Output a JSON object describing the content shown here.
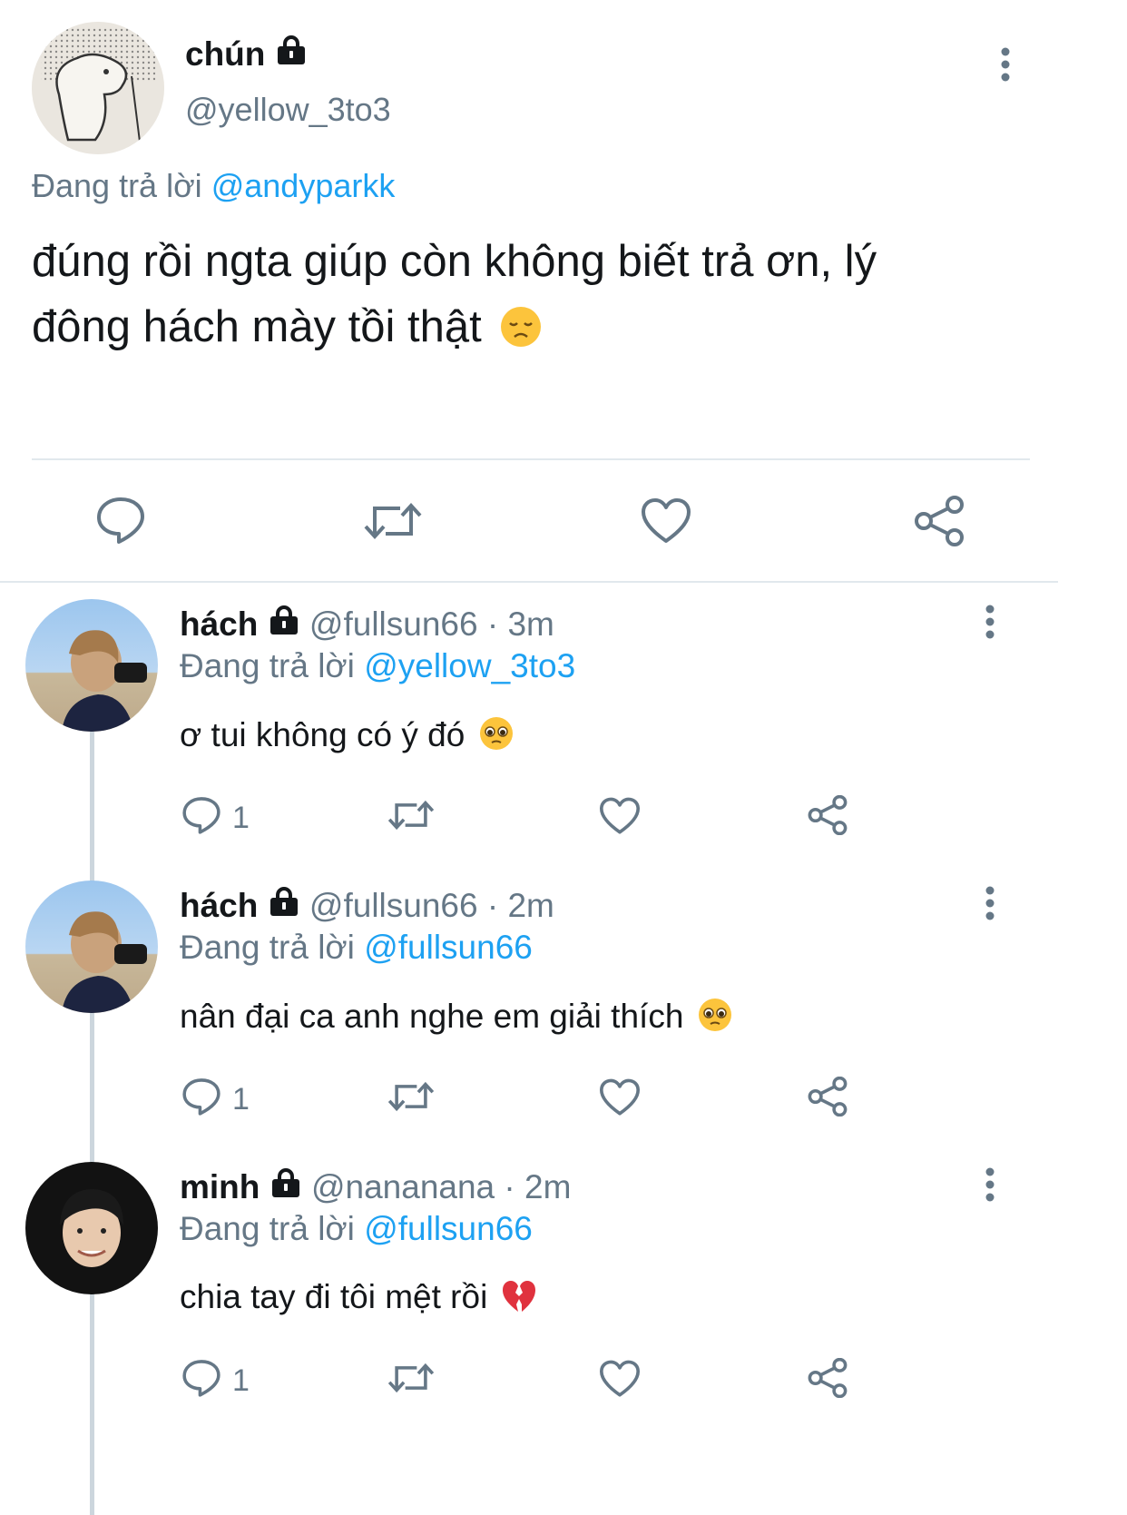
{
  "main_tweet": {
    "display_name": "chún",
    "handle": "@yellow_3to3",
    "reply_prefix": "Đang trả lời",
    "reply_to": "@andyparkk",
    "text_line1": "đúng rồi ngta giúp còn không biết trả ơn, lý",
    "text_line2": "đông hách mày tồi thật",
    "emoji": "disappointed-face",
    "actions": [
      "reply-icon",
      "retweet-icon",
      "like-icon",
      "share-icon"
    ]
  },
  "replies": [
    {
      "display_name": "hách",
      "handle": "@fullsun66",
      "time": "· 3m",
      "reply_prefix": "Đang trả lời",
      "reply_to": "@yellow_3to3",
      "text": "ơ tui không có ý đó",
      "emoji": "pleading-face",
      "reply_count": "1"
    },
    {
      "display_name": "hách",
      "handle": "@fullsun66",
      "time": "· 2m",
      "reply_prefix": "Đang trả lời",
      "reply_to": "@fullsun66",
      "text": "nân đại ca anh nghe em giải thích",
      "emoji": "pleading-face",
      "reply_count": "1"
    },
    {
      "display_name": "minh",
      "handle": "@nananana",
      "time": "· 2m",
      "reply_prefix": "Đang trả lời",
      "reply_to": "@fullsun66",
      "text": "chia tay đi tôi mệt rồi",
      "emoji": "broken-heart",
      "reply_count": "1"
    }
  ],
  "colors": {
    "link": "#1da1f2",
    "muted": "#657786",
    "text": "#14171a",
    "divider": "#e1e8ed",
    "thread_line": "#ccd6dd"
  }
}
